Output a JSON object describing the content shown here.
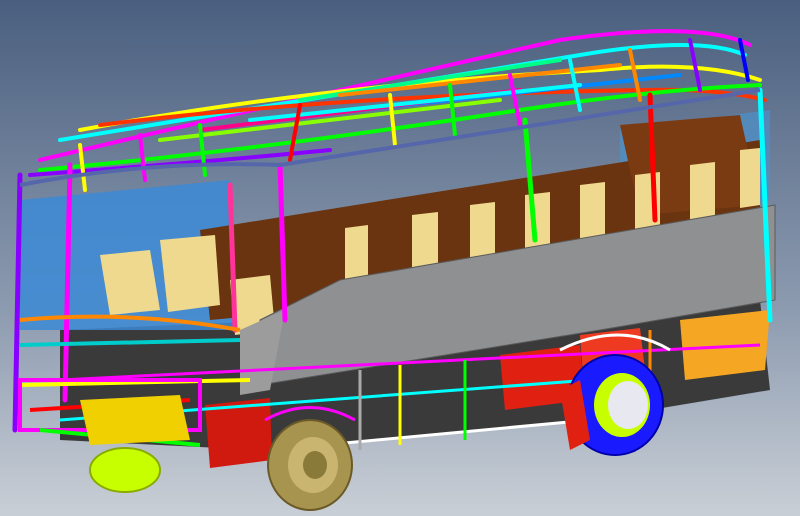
{
  "scene": {
    "subject": "bus-chassis-fem-model",
    "background": {
      "top": "#4a5f7f",
      "bottom": "#c9cfd6"
    },
    "colors": {
      "roof_frame": [
        "#ff00ff",
        "#00ffff",
        "#ffff00",
        "#ff0000",
        "#00ff00",
        "#0000ff",
        "#ff8800",
        "#8800ff",
        "#00ff88"
      ],
      "panel_gray": "#8f9092",
      "seat_back": "#6b3410",
      "seat_cushion": "#efd98e",
      "wheel_tire_rear": "#1a1aff",
      "wheel_tire_front": "#c8ff00",
      "wheel_hub": "#c9b470",
      "red_panel": "#e02010",
      "orange_panel": "#f5a623",
      "window_blue": "#3c89d6"
    }
  },
  "corner_label": ""
}
